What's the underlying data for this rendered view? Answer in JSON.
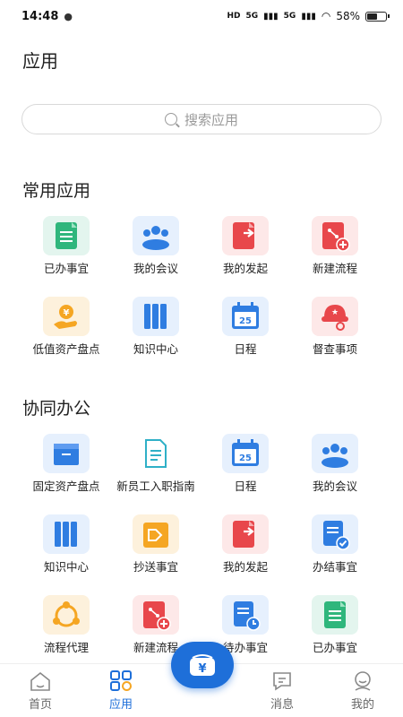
{
  "status": {
    "time": "14:48",
    "battery": "58%",
    "battery_level": 0.58,
    "net1": "5G",
    "net2": "5G",
    "hd": "HD"
  },
  "page_title": "应用",
  "search": {
    "placeholder": "搜索应用"
  },
  "sections": [
    {
      "title": "常用应用",
      "items": [
        {
          "label": "已办事宜",
          "icon": "done-doc-icon"
        },
        {
          "label": "我的会议",
          "icon": "meeting-icon"
        },
        {
          "label": "我的发起",
          "icon": "send-doc-icon"
        },
        {
          "label": "新建流程",
          "icon": "new-flow-icon"
        },
        {
          "label": "低值资产盘点",
          "icon": "asset-coin-icon"
        },
        {
          "label": "知识中心",
          "icon": "books-icon"
        },
        {
          "label": "日程",
          "icon": "calendar-icon"
        },
        {
          "label": "督查事项",
          "icon": "inspector-icon"
        }
      ]
    },
    {
      "title": "协同办公",
      "items": [
        {
          "label": "固定资产盘点",
          "icon": "box-icon"
        },
        {
          "label": "新员工入职指南",
          "icon": "guide-doc-icon"
        },
        {
          "label": "日程",
          "icon": "calendar-icon"
        },
        {
          "label": "我的会议",
          "icon": "meeting-icon"
        },
        {
          "label": "知识中心",
          "icon": "books-icon"
        },
        {
          "label": "抄送事宜",
          "icon": "cc-doc-icon"
        },
        {
          "label": "我的发起",
          "icon": "send-doc-icon"
        },
        {
          "label": "办结事宜",
          "icon": "finished-icon"
        },
        {
          "label": "流程代理",
          "icon": "proxy-flow-icon"
        },
        {
          "label": "新建流程",
          "icon": "new-flow-icon"
        },
        {
          "label": "待办事宜",
          "icon": "todo-icon"
        },
        {
          "label": "已办事宜",
          "icon": "done-doc-icon"
        }
      ]
    }
  ],
  "calendar_day": "25",
  "tabs": [
    {
      "label": "首页",
      "icon": "home-icon",
      "active": false
    },
    {
      "label": "应用",
      "icon": "apps-icon",
      "active": true
    },
    {
      "label": "",
      "icon": "",
      "active": false
    },
    {
      "label": "消息",
      "icon": "message-icon",
      "active": false
    },
    {
      "label": "我的",
      "icon": "profile-icon",
      "active": false
    }
  ],
  "fab": {
    "icon": "wallet-yen-icon"
  },
  "colors": {
    "accent": "#1e6fd9",
    "green": "#2fb67c",
    "red": "#e8474b",
    "orange": "#f5a623",
    "blue": "#2f7de1"
  }
}
